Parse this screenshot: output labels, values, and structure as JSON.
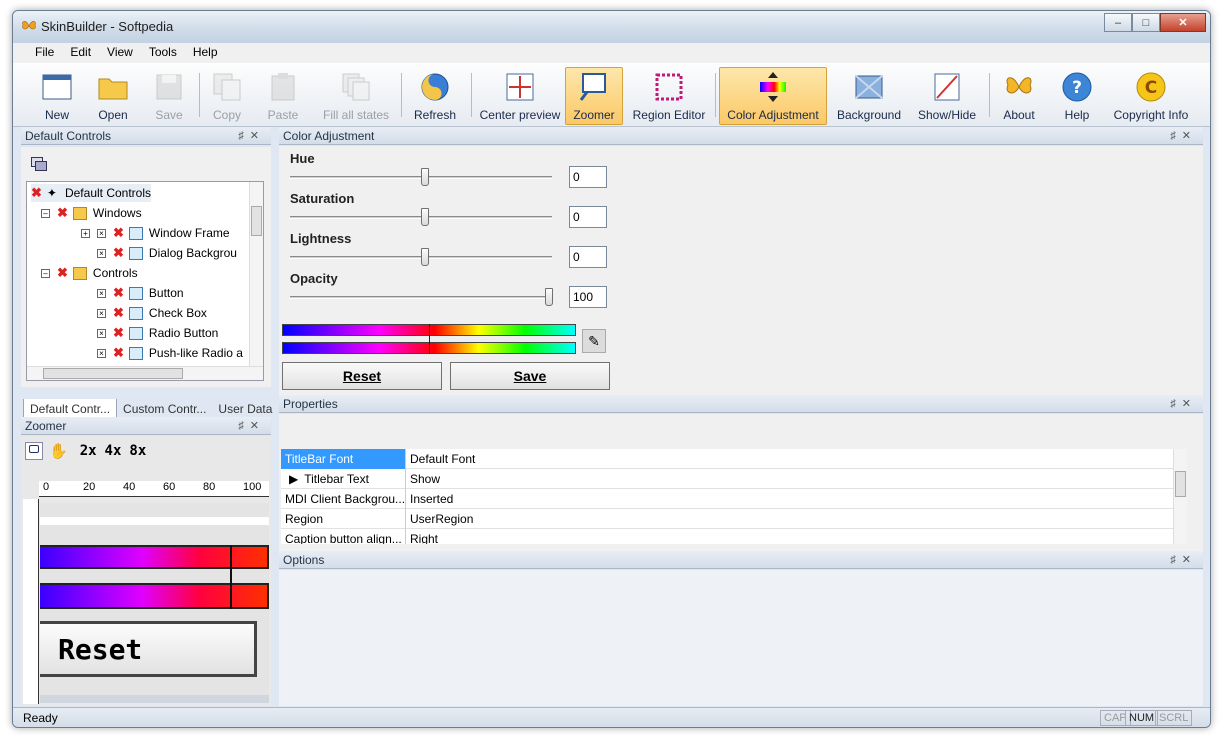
{
  "window": {
    "title": "SkinBuilder - Softpedia"
  },
  "menu": [
    "File",
    "Edit",
    "View",
    "Tools",
    "Help"
  ],
  "toolbar": [
    {
      "label": "New",
      "icon": "new-window-icon",
      "disabled": false
    },
    {
      "label": "Open",
      "icon": "folder-open-icon",
      "disabled": false
    },
    {
      "label": "Save",
      "icon": "floppy-save-icon",
      "disabled": true
    },
    {
      "label": "Copy",
      "icon": "copy-icon",
      "disabled": true
    },
    {
      "label": "Paste",
      "icon": "paste-icon",
      "disabled": true
    },
    {
      "label": "Fill all states",
      "icon": "fill-states-icon",
      "disabled": true
    },
    {
      "label": "Refresh",
      "icon": "refresh-yin-yang-icon",
      "disabled": false
    },
    {
      "label": "Center preview",
      "icon": "center-preview-icon",
      "disabled": false
    },
    {
      "label": "Zoomer",
      "icon": "zoomer-magnifier-icon",
      "disabled": false,
      "active": true
    },
    {
      "label": "Region Editor",
      "icon": "region-editor-icon",
      "disabled": false
    },
    {
      "label": "Color Adjustment",
      "icon": "color-adjustment-icon",
      "disabled": false,
      "active": true
    },
    {
      "label": "Background",
      "icon": "background-icon",
      "disabled": false
    },
    {
      "label": "Show/Hide",
      "icon": "show-hide-icon",
      "disabled": false
    },
    {
      "label": "About",
      "icon": "about-butterfly-icon",
      "disabled": false
    },
    {
      "label": "Help",
      "icon": "help-icon",
      "disabled": false
    },
    {
      "label": "Copyright Info",
      "icon": "copyright-icon",
      "disabled": false
    }
  ],
  "panels": {
    "default_controls": "Default Controls",
    "color_adjustment": "Color Adjustment",
    "properties": "Properties",
    "zoomer": "Zoomer",
    "options": "Options"
  },
  "tree": [
    {
      "label": "Default Controls",
      "level": 0
    },
    {
      "label": "Windows",
      "level": 1
    },
    {
      "label": "Window Frame",
      "level": 2
    },
    {
      "label": "Dialog Backgrou",
      "level": 2
    },
    {
      "label": "Controls",
      "level": 1
    },
    {
      "label": "Button",
      "level": 2
    },
    {
      "label": "Check Box",
      "level": 2
    },
    {
      "label": "Radio Button",
      "level": 2
    },
    {
      "label": "Push-like Radio a",
      "level": 2
    }
  ],
  "tabs": [
    "Default Contr...",
    "Custom Contr...",
    "User Data"
  ],
  "color_adjust": {
    "hue": {
      "label": "Hue",
      "value": "0"
    },
    "saturation": {
      "label": "Saturation",
      "value": "0"
    },
    "lightness": {
      "label": "Lightness",
      "value": "0"
    },
    "opacity": {
      "label": "Opacity",
      "value": "100"
    },
    "reset": "Reset",
    "save": "Save"
  },
  "properties": [
    {
      "key": "TitleBar Font",
      "value": "Default Font"
    },
    {
      "key": "Titlebar Text",
      "value": "Show"
    },
    {
      "key": "MDI Client Backgrou...",
      "value": "Inserted"
    },
    {
      "key": "Region",
      "value": "UserRegion"
    },
    {
      "key": "Caption button align...",
      "value": "Right"
    }
  ],
  "zoomer": {
    "zoom_levels": [
      "2x",
      "4x",
      "8x"
    ],
    "ruler_ticks": [
      "0",
      "20",
      "40",
      "60",
      "80",
      "100"
    ],
    "preview_button": "Reset"
  },
  "status": {
    "text": "Ready",
    "indicators": [
      "CAP",
      "NUM",
      "SCRL"
    ]
  }
}
